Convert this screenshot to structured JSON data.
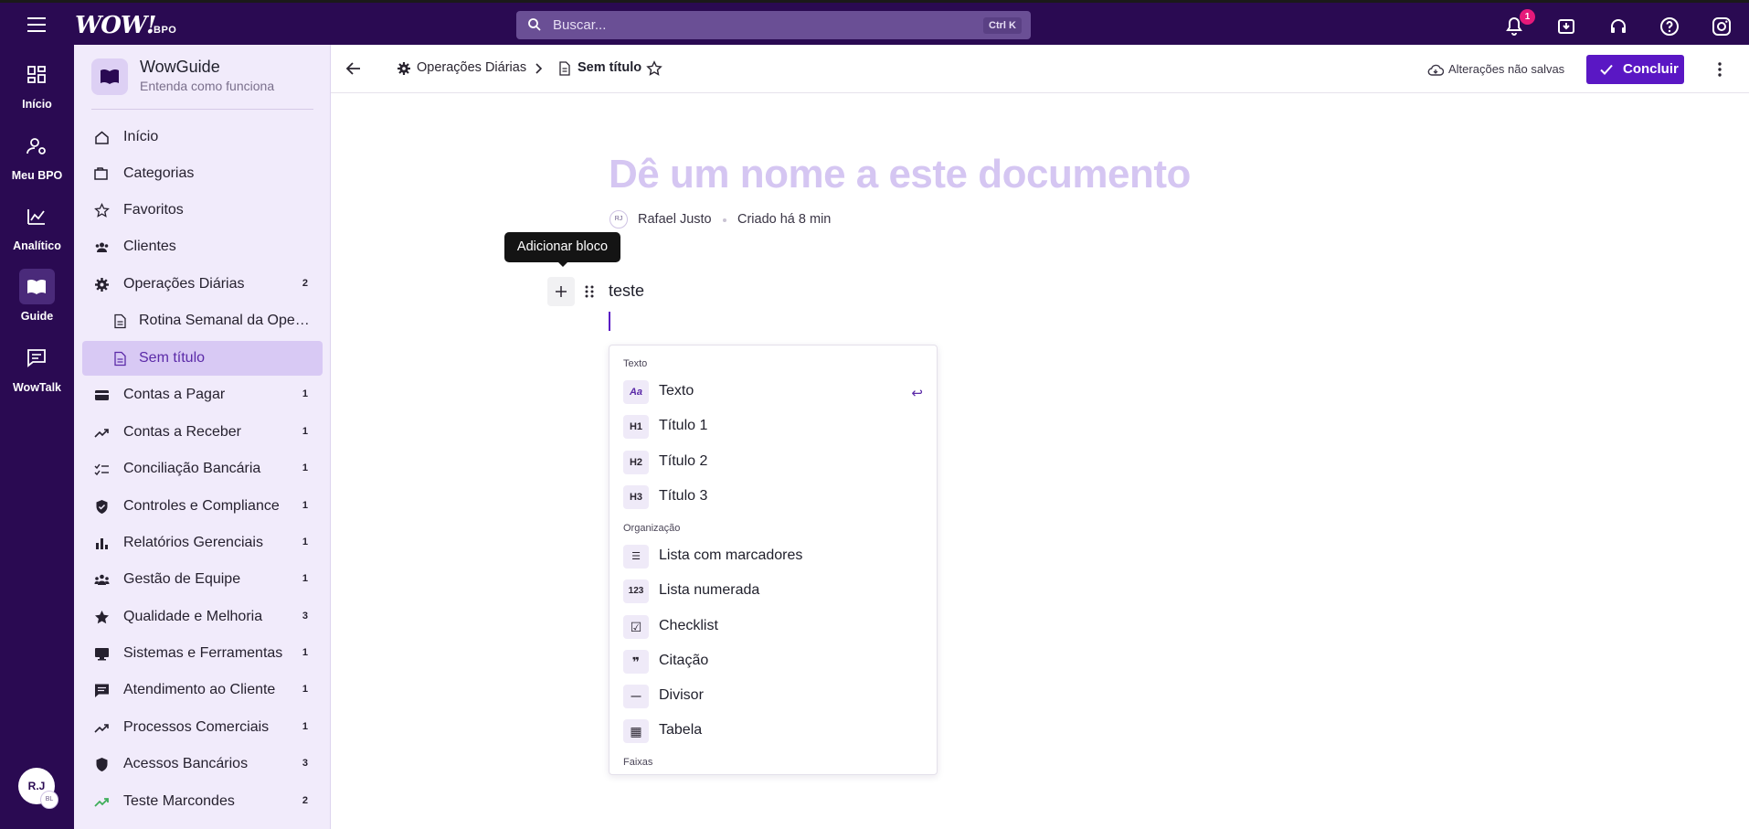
{
  "topbar": {
    "logo_text": "WOW!",
    "logo_sub": "BPO",
    "search_placeholder": "Buscar...",
    "search_shortcut": "Ctrl K",
    "notification_count": "1"
  },
  "rail": {
    "items": [
      {
        "label": "Início",
        "icon": "dashboard-grid-icon"
      },
      {
        "label": "Meu BPO",
        "icon": "user-settings-icon"
      },
      {
        "label": "Analítico",
        "icon": "chart-line-icon"
      },
      {
        "label": "Guide",
        "icon": "book-open-icon"
      },
      {
        "label": "WowTalk",
        "icon": "chat-icon"
      }
    ],
    "avatar_initials": "R.J",
    "avatar_sub": "BL"
  },
  "sidebar": {
    "brand_title": "WowGuide",
    "brand_subtitle": "Entenda como funciona",
    "items": [
      {
        "label": "Início",
        "count": ""
      },
      {
        "label": "Categorias",
        "count": ""
      },
      {
        "label": "Favoritos",
        "count": ""
      },
      {
        "label": "Clientes",
        "count": ""
      },
      {
        "label": "Operações Diárias",
        "count": "2"
      },
      {
        "label": "Rotina Semanal da Operação",
        "count": ""
      },
      {
        "label": "Sem título",
        "count": ""
      },
      {
        "label": "Contas a Pagar",
        "count": "1"
      },
      {
        "label": "Contas a Receber",
        "count": "1"
      },
      {
        "label": "Conciliação Bancária",
        "count": "1"
      },
      {
        "label": "Controles e Compliance",
        "count": "1"
      },
      {
        "label": "Relatórios Gerenciais",
        "count": "1"
      },
      {
        "label": "Gestão de Equipe",
        "count": "1"
      },
      {
        "label": "Qualidade e Melhoria",
        "count": "3"
      },
      {
        "label": "Sistemas e Ferramentas",
        "count": "1"
      },
      {
        "label": "Atendimento ao Cliente",
        "count": "1"
      },
      {
        "label": "Processos Comerciais",
        "count": "1"
      },
      {
        "label": "Acessos Bancários",
        "count": "3"
      },
      {
        "label": "Teste Marcondes",
        "count": "2"
      }
    ]
  },
  "header": {
    "breadcrumb_parent": "Operações Diárias",
    "breadcrumb_current": "Sem título",
    "save_status": "Alterações não salvas",
    "conclude_label": "Concluir"
  },
  "document": {
    "title_placeholder": "Dê um nome a este documento",
    "author_initials": "RJ",
    "author_name": "Rafael Justo",
    "created_text": "Criado há 8 min",
    "tooltip": "Adicionar bloco",
    "block_text": "teste"
  },
  "slash_menu": {
    "section_text": "Texto",
    "section_org": "Organização",
    "section_bands": "Faixas",
    "items": [
      {
        "label": "Texto",
        "icon_text": "Aa"
      },
      {
        "label": "Título 1",
        "icon_text": "H1"
      },
      {
        "label": "Título 2",
        "icon_text": "H2"
      },
      {
        "label": "Título 3",
        "icon_text": "H3"
      },
      {
        "label": "Lista com marcadores",
        "icon_text": "☰"
      },
      {
        "label": "Lista numerada",
        "icon_text": "123"
      },
      {
        "label": "Checklist",
        "icon_text": "☑"
      },
      {
        "label": "Citação",
        "icon_text": "❞"
      },
      {
        "label": "Divisor",
        "icon_text": "—"
      },
      {
        "label": "Tabela",
        "icon_text": "▦"
      }
    ]
  },
  "colors": {
    "brand_dark": "#2a0a52",
    "accent": "#5a17c4",
    "sidebar_bg": "#f1ebfb",
    "badge": "#e6197a"
  }
}
